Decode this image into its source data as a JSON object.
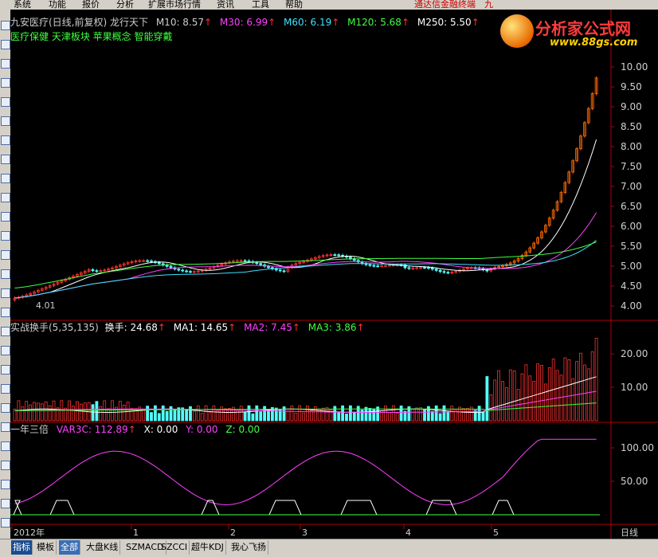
{
  "menu": {
    "items": [
      "系统",
      "功能",
      "报价",
      "分析",
      "扩展市场行情",
      "资讯",
      "工具",
      "帮助"
    ],
    "right_title": "通达信金融终端",
    "right_extra": "九"
  },
  "logo": {
    "title": "分析家公式网",
    "url": "www.88gs.com"
  },
  "price_panel": {
    "title": "九安医疗(日线,前复权) 龙行天下",
    "ma": [
      {
        "label": "M10: 8.57",
        "color": "#ffffff"
      },
      {
        "label": "M30: 6.99",
        "color": "#ff40ff"
      },
      {
        "label": "M60: 6.19",
        "color": "#40e0ff"
      },
      {
        "label": "M120: 5.68",
        "color": "#40ff40"
      },
      {
        "label": "M250: 5.50",
        "color": "#ffffff"
      }
    ],
    "concepts": "医疗保健 天津板块 苹果概念 智能穿戴",
    "low_label": "4.01",
    "axis": [
      "10.00",
      "9.50",
      "9.00",
      "8.50",
      "8.00",
      "7.50",
      "7.00",
      "6.50",
      "6.00",
      "5.50",
      "5.00",
      "4.50",
      "4.00"
    ]
  },
  "volume_panel": {
    "title": "实战换手(5,35,135)",
    "items": [
      {
        "label": "换手: 24.68",
        "color": "#ffffff"
      },
      {
        "label": "MA1: 14.65",
        "color": "#ffffff"
      },
      {
        "label": "MA2: 7.45",
        "color": "#ff40ff"
      },
      {
        "label": "MA3: 3.86",
        "color": "#40ff40"
      }
    ],
    "axis": [
      "20.00",
      "10.00"
    ]
  },
  "indicator_panel": {
    "title": "一年三倍",
    "items": [
      {
        "label": "VAR3C: 112.89",
        "color": "#ff40ff"
      },
      {
        "label": "X: 0.00",
        "color": "#ffffff"
      },
      {
        "label": "Y: 0.00",
        "color": "#ff40ff"
      },
      {
        "label": "Z: 0.00",
        "color": "#40ff40"
      }
    ],
    "axis": [
      "100.00",
      "50.00"
    ]
  },
  "time_axis": {
    "labels": [
      "2012年",
      "1",
      "2",
      "3",
      "4",
      "5"
    ],
    "period": "日线"
  },
  "bottom_tabs": [
    "指标",
    "模板",
    "全部",
    "大盘K线",
    "SZMACD",
    "SZCCI",
    "超牛KDJ",
    "我心飞扬"
  ],
  "colors": {
    "up": "#ff3030",
    "down": "#54ffff",
    "frame": "#b00000",
    "background": "#000000"
  }
}
